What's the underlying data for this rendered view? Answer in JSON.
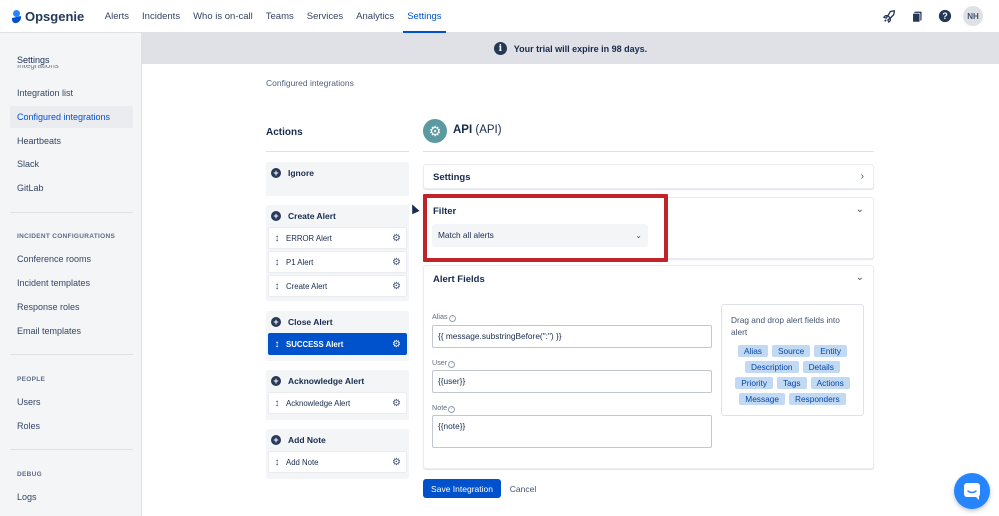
{
  "app": {
    "name": "Opsgenie"
  },
  "nav": {
    "items": [
      "Alerts",
      "Incidents",
      "Who is on-call",
      "Teams",
      "Services",
      "Analytics",
      "Settings"
    ],
    "active": "Settings",
    "icons": [
      "rocket-icon",
      "notebook-icon",
      "help-icon"
    ],
    "avatar": "NH"
  },
  "banner": {
    "text": "Your trial will expire in 98 days."
  },
  "sidebar": {
    "title": "Settings",
    "cut_text": "Integrations",
    "items": [
      "Integration list",
      "Configured integrations",
      "Heartbeats",
      "Slack",
      "GitLab"
    ],
    "active": "Configured integrations",
    "sections": [
      {
        "heading": "INCIDENT CONFIGURATIONS",
        "items": [
          "Conference rooms",
          "Incident templates",
          "Response roles",
          "Email templates"
        ]
      },
      {
        "heading": "PEOPLE",
        "items": [
          "Users",
          "Roles"
        ]
      },
      {
        "heading": "DEBUG",
        "items": [
          "Logs"
        ]
      }
    ]
  },
  "breadcrumb": "Configured integrations",
  "actions": {
    "title": "Actions",
    "groups": [
      {
        "label": "Ignore",
        "items": []
      },
      {
        "label": "Create Alert",
        "items": [
          "ERROR Alert",
          "P1 Alert",
          "Create Alert"
        ]
      },
      {
        "label": "Close Alert",
        "items": [
          "SUCCESS Alert"
        ]
      },
      {
        "label": "Acknowledge Alert",
        "items": [
          "Acknowledge Alert"
        ]
      },
      {
        "label": "Add Note",
        "items": [
          "Add Note"
        ]
      }
    ],
    "selected": "SUCCESS Alert"
  },
  "integration": {
    "name": "API",
    "type": "(API)",
    "settings_label": "Settings",
    "filter": {
      "label": "Filter",
      "value": "Match all alerts"
    },
    "alert_fields": {
      "label": "Alert Fields",
      "alias": {
        "label": "Alias",
        "value": "{{ message.substringBefore(\":\") }}"
      },
      "user": {
        "label": "User",
        "value": "{{user}}"
      },
      "note": {
        "label": "Note",
        "value": "{{note}}"
      },
      "drag_hint": "Drag and drop alert fields into alert",
      "chips": [
        [
          "Alias",
          "Source",
          "Entity"
        ],
        [
          "Description",
          "Details"
        ],
        [
          "Priority",
          "Tags",
          "Actions"
        ],
        [
          "Message",
          "Responders"
        ]
      ]
    }
  },
  "buttons": {
    "save": "Save Integration",
    "cancel": "Cancel"
  },
  "colors": {
    "primary": "#0052cc",
    "highlight": "#c0242b",
    "chip_bg": "#c1d9f2"
  }
}
